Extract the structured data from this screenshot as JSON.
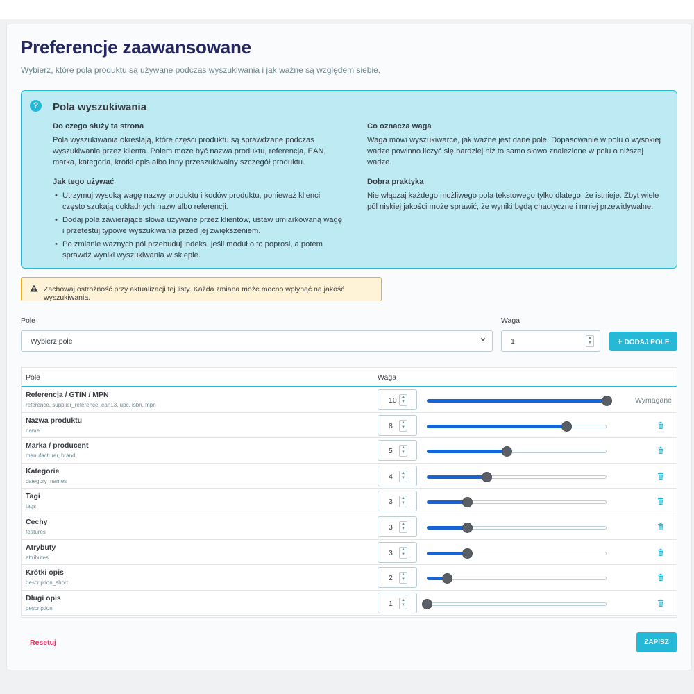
{
  "page": {
    "title": "Preferencje zaawansowane",
    "subtitle": "Wybierz, które pola produktu są używane podczas wyszukiwania i jak ważne są względem siebie."
  },
  "info": {
    "icon": "question-circle-icon",
    "title": "Pola wyszukiwania",
    "what_heading": "Do czego służy ta strona",
    "what_text": "Pola wyszukiwania określają, które części produktu są sprawdzane podczas wyszukiwania przez klienta. Polem może być nazwa produktu, referencja, EAN, marka, kategoria, krótki opis albo inny przeszukiwalny szczegół produktu.",
    "how_heading": "Jak tego używać",
    "how_items": [
      "Utrzymuj wysoką wagę nazwy produktu i kodów produktu, ponieważ klienci często szukają dokładnych nazw albo referencji.",
      "Dodaj pola zawierające słowa używane przez klientów, ustaw umiarkowaną wagę i przetestuj typowe wyszukiwania przed jej zwiększeniem.",
      "Po zmianie ważnych pól przebuduj indeks, jeśli moduł o to poprosi, a potem sprawdź wyniki wyszukiwania w sklepie."
    ],
    "weight_heading": "Co oznacza waga",
    "weight_text": "Waga mówi wyszukiwarce, jak ważne jest dane pole. Dopasowanie w polu o wysokiej wadze powinno liczyć się bardziej niż to samo słowo znalezione w polu o niższej wadze.",
    "practice_heading": "Dobra praktyka",
    "practice_text": "Nie włączaj każdego możliwego pola tekstowego tylko dlatego, że istnieje. Zbyt wiele pól niskiej jakości może sprawić, że wyniki będą chaotyczne i mniej przewidywalne."
  },
  "warning": {
    "icon": "warning-triangle-icon",
    "text": "Zachowaj ostrożność przy aktualizacji tej listy. Każda zmiana może mocno wpłynąć na jakość wyszukiwania."
  },
  "add_form": {
    "field_label": "Pole",
    "field_placeholder": "Wybierz pole",
    "weight_label": "Waga",
    "weight_value": "1",
    "add_button": "DODAJ POLE",
    "add_icon": "plus-icon"
  },
  "table": {
    "col_field": "Pole",
    "col_weight": "Waga",
    "max_weight": 10,
    "min_weight": 1,
    "rows": [
      {
        "name": "Referencja / GTIN / MPN",
        "keys": "reference, supplier_reference, ean13, upc, isbn, mpn",
        "weight": "10",
        "required": "Wymagane"
      },
      {
        "name": "Nazwa produktu",
        "keys": "name",
        "weight": "8"
      },
      {
        "name": "Marka / producent",
        "keys": "manufacturer, brand",
        "weight": "5"
      },
      {
        "name": "Kategorie",
        "keys": "category_names",
        "weight": "4"
      },
      {
        "name": "Tagi",
        "keys": "tags",
        "weight": "3"
      },
      {
        "name": "Cechy",
        "keys": "features",
        "weight": "3"
      },
      {
        "name": "Atrybuty",
        "keys": "attributes",
        "weight": "3"
      },
      {
        "name": "Krótki opis",
        "keys": "description_short",
        "weight": "2"
      },
      {
        "name": "Długi opis",
        "keys": "description",
        "weight": "1"
      }
    ]
  },
  "footer": {
    "reset_label": "Resetuj",
    "save_label": "ZAPISZ"
  },
  "colors": {
    "accent": "#25b9d7",
    "slider_fill": "#1664d6",
    "danger": "#e0305d",
    "title": "#25285f"
  }
}
